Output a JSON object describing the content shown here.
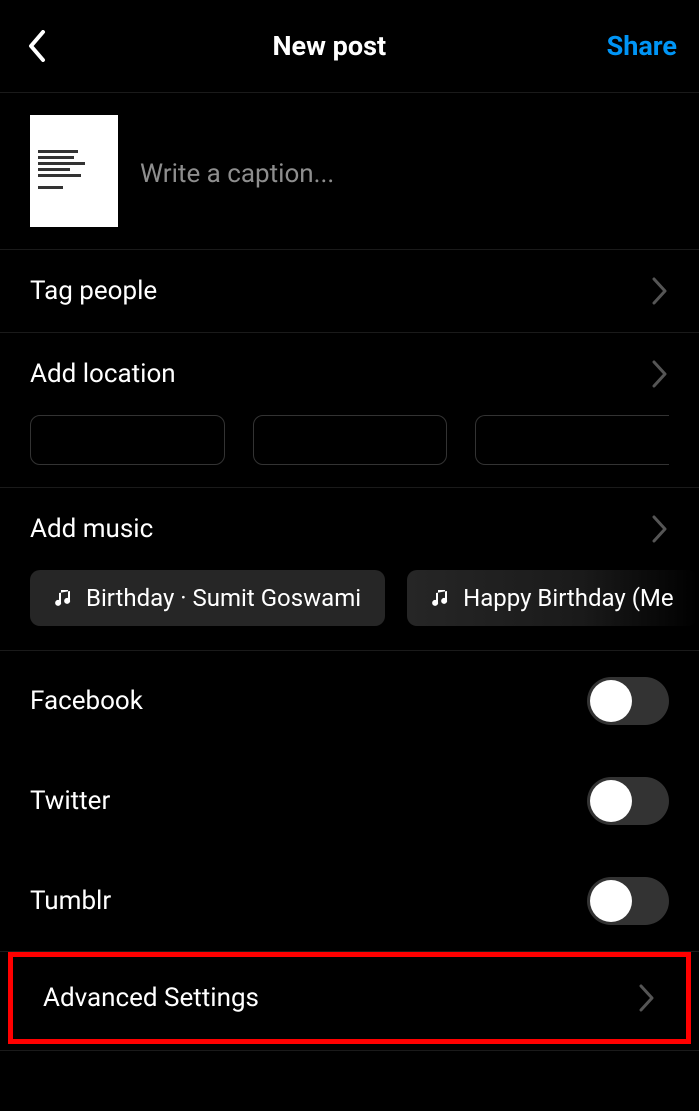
{
  "header": {
    "title": "New post",
    "share": "Share"
  },
  "caption": {
    "placeholder": "Write a caption..."
  },
  "rows": {
    "tagPeople": "Tag people",
    "addLocation": "Add location",
    "addMusic": "Add music",
    "advanced": "Advanced Settings"
  },
  "music": {
    "chip1": "Birthday · Sumit Goswami",
    "chip2": "Happy Birthday (Me"
  },
  "shareTargets": {
    "facebook": "Facebook",
    "twitter": "Twitter",
    "tumblr": "Tumblr"
  }
}
